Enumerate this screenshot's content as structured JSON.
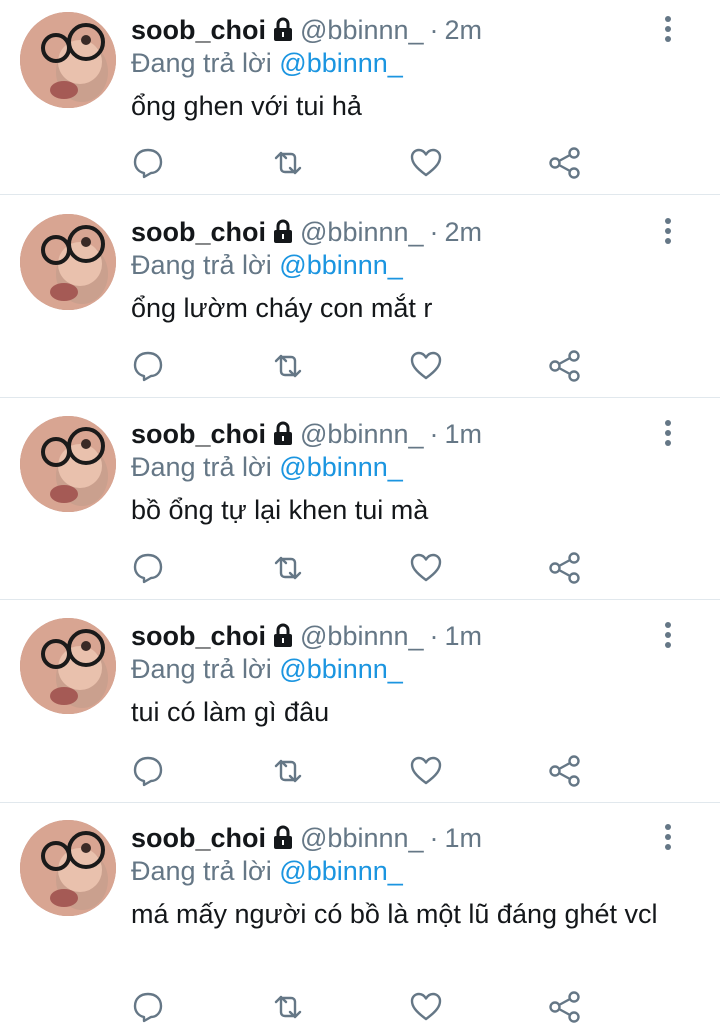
{
  "tweets": [
    {
      "display_name": "soob_choi",
      "handle": "@bbinnn_",
      "separator": "·",
      "time": "2m",
      "replying_prefix": "Đang trả lời",
      "replying_to": "@bbinnn_",
      "text": "ổng ghen với tui hả"
    },
    {
      "display_name": "soob_choi",
      "handle": "@bbinnn_",
      "separator": "·",
      "time": "2m",
      "replying_prefix": "Đang trả lời",
      "replying_to": "@bbinnn_",
      "text": "ổng lườm cháy con mắt r"
    },
    {
      "display_name": "soob_choi",
      "handle": "@bbinnn_",
      "separator": "·",
      "time": "1m",
      "replying_prefix": "Đang trả lời",
      "replying_to": "@bbinnn_",
      "text": "bồ ổng tự lại khen tui mà"
    },
    {
      "display_name": "soob_choi",
      "handle": "@bbinnn_",
      "separator": "·",
      "time": "1m",
      "replying_prefix": "Đang trả lời",
      "replying_to": "@bbinnn_",
      "text": "tui có làm gì đâu"
    },
    {
      "display_name": "soob_choi",
      "handle": "@bbinnn_",
      "separator": "·",
      "time": "1m",
      "replying_prefix": "Đang trả lời",
      "replying_to": "@bbinnn_",
      "text": "má mấy người có bồ là một lũ đáng ghét vcl"
    }
  ],
  "icons": {
    "reply": "reply-icon",
    "retweet": "retweet-icon",
    "like": "heart-icon",
    "share": "share-icon",
    "more": "more-vertical-icon",
    "lock": "lock-icon"
  },
  "colors": {
    "text": "#14171a",
    "secondary": "#657786",
    "link": "#1b95e0",
    "divider": "#e1e8ed"
  }
}
